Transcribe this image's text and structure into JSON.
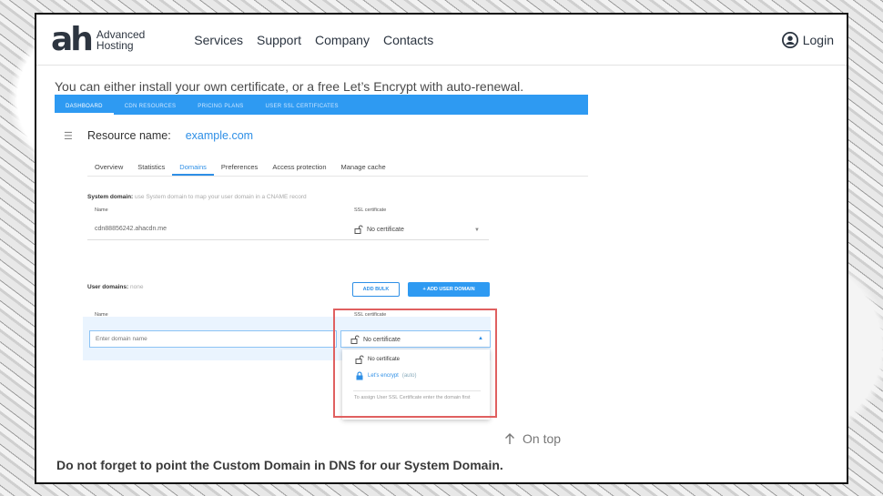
{
  "header": {
    "logo_mark": "ah",
    "logo_line1": "Advanced",
    "logo_line2": "Hosting",
    "nav": [
      "Services",
      "Support",
      "Company",
      "Contacts"
    ],
    "login_label": "Login"
  },
  "intro_text": "You can either install your own certificate, or a free Let’s Encrypt with auto-renewal.",
  "screenshot": {
    "top_tabs": [
      "DASHBOARD",
      "CDN RESOURCES",
      "PRICING PLANS",
      "USER SSL CERTIFICATES"
    ],
    "resource_label": "Resource name:",
    "resource_value": "example.com",
    "sub_tabs": [
      "Overview",
      "Statistics",
      "Domains",
      "Preferences",
      "Access protection",
      "Manage cache"
    ],
    "active_sub_tab": "Domains",
    "system_domain_title": "System domain:",
    "system_domain_hint": "use System domain to map your user domain in a CNAME record",
    "col_name": "Name",
    "col_ssl": "SSL certificate",
    "system_domain_value": "cdn88856242.ahacdn.me",
    "no_certificate": "No certificate",
    "user_domains_title": "User domains:",
    "user_domains_value": "none",
    "add_bulk": "ADD BULK",
    "add_user_domain": "+ ADD USER DOMAIN",
    "domain_placeholder": "Enter domain name",
    "dropdown": {
      "option1": "No certificate",
      "option2": "Let's encrypt",
      "option2_suffix": "(auto)",
      "note": "To assign User SSL Certificate enter the domain first"
    },
    "highlight_color": "#e06060",
    "accent_color": "#2e9af2"
  },
  "on_top_label": "On top",
  "outro_text": "Do not forget to point the Custom Domain in DNS for our System Domain."
}
